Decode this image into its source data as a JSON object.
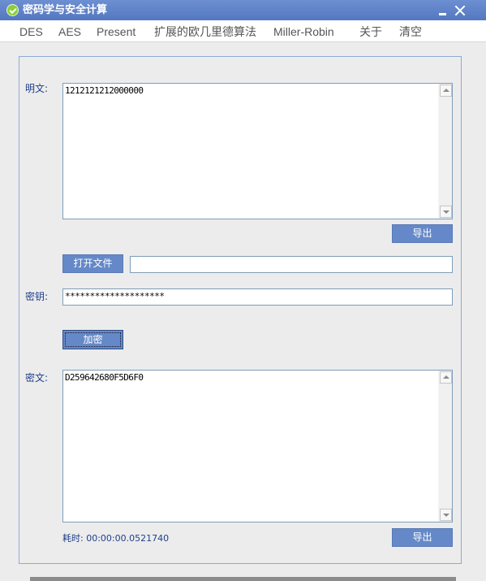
{
  "window": {
    "title": "密码学与安全计算",
    "icon": "check-circle-icon",
    "accent_color": "#5a7ec4"
  },
  "menu": [
    {
      "label": "DES"
    },
    {
      "label": "AES"
    },
    {
      "label": "Present"
    },
    {
      "label": "扩展的欧几里德算法"
    },
    {
      "label": "Miller-Robin"
    },
    {
      "label": "关于"
    },
    {
      "label": "清空"
    }
  ],
  "plaintext": {
    "label": "明文:",
    "value": "1212121212000000",
    "export_label": "导出"
  },
  "file": {
    "open_label": "打开文件",
    "path_value": ""
  },
  "key": {
    "label": "密钥:",
    "value": "********************"
  },
  "encrypt": {
    "label": "加密"
  },
  "ciphertext": {
    "label": "密文:",
    "value": "D259642680F5D6F0",
    "export_label": "导出"
  },
  "status": {
    "elapsed": "耗时: 00:00:00.0521740"
  }
}
